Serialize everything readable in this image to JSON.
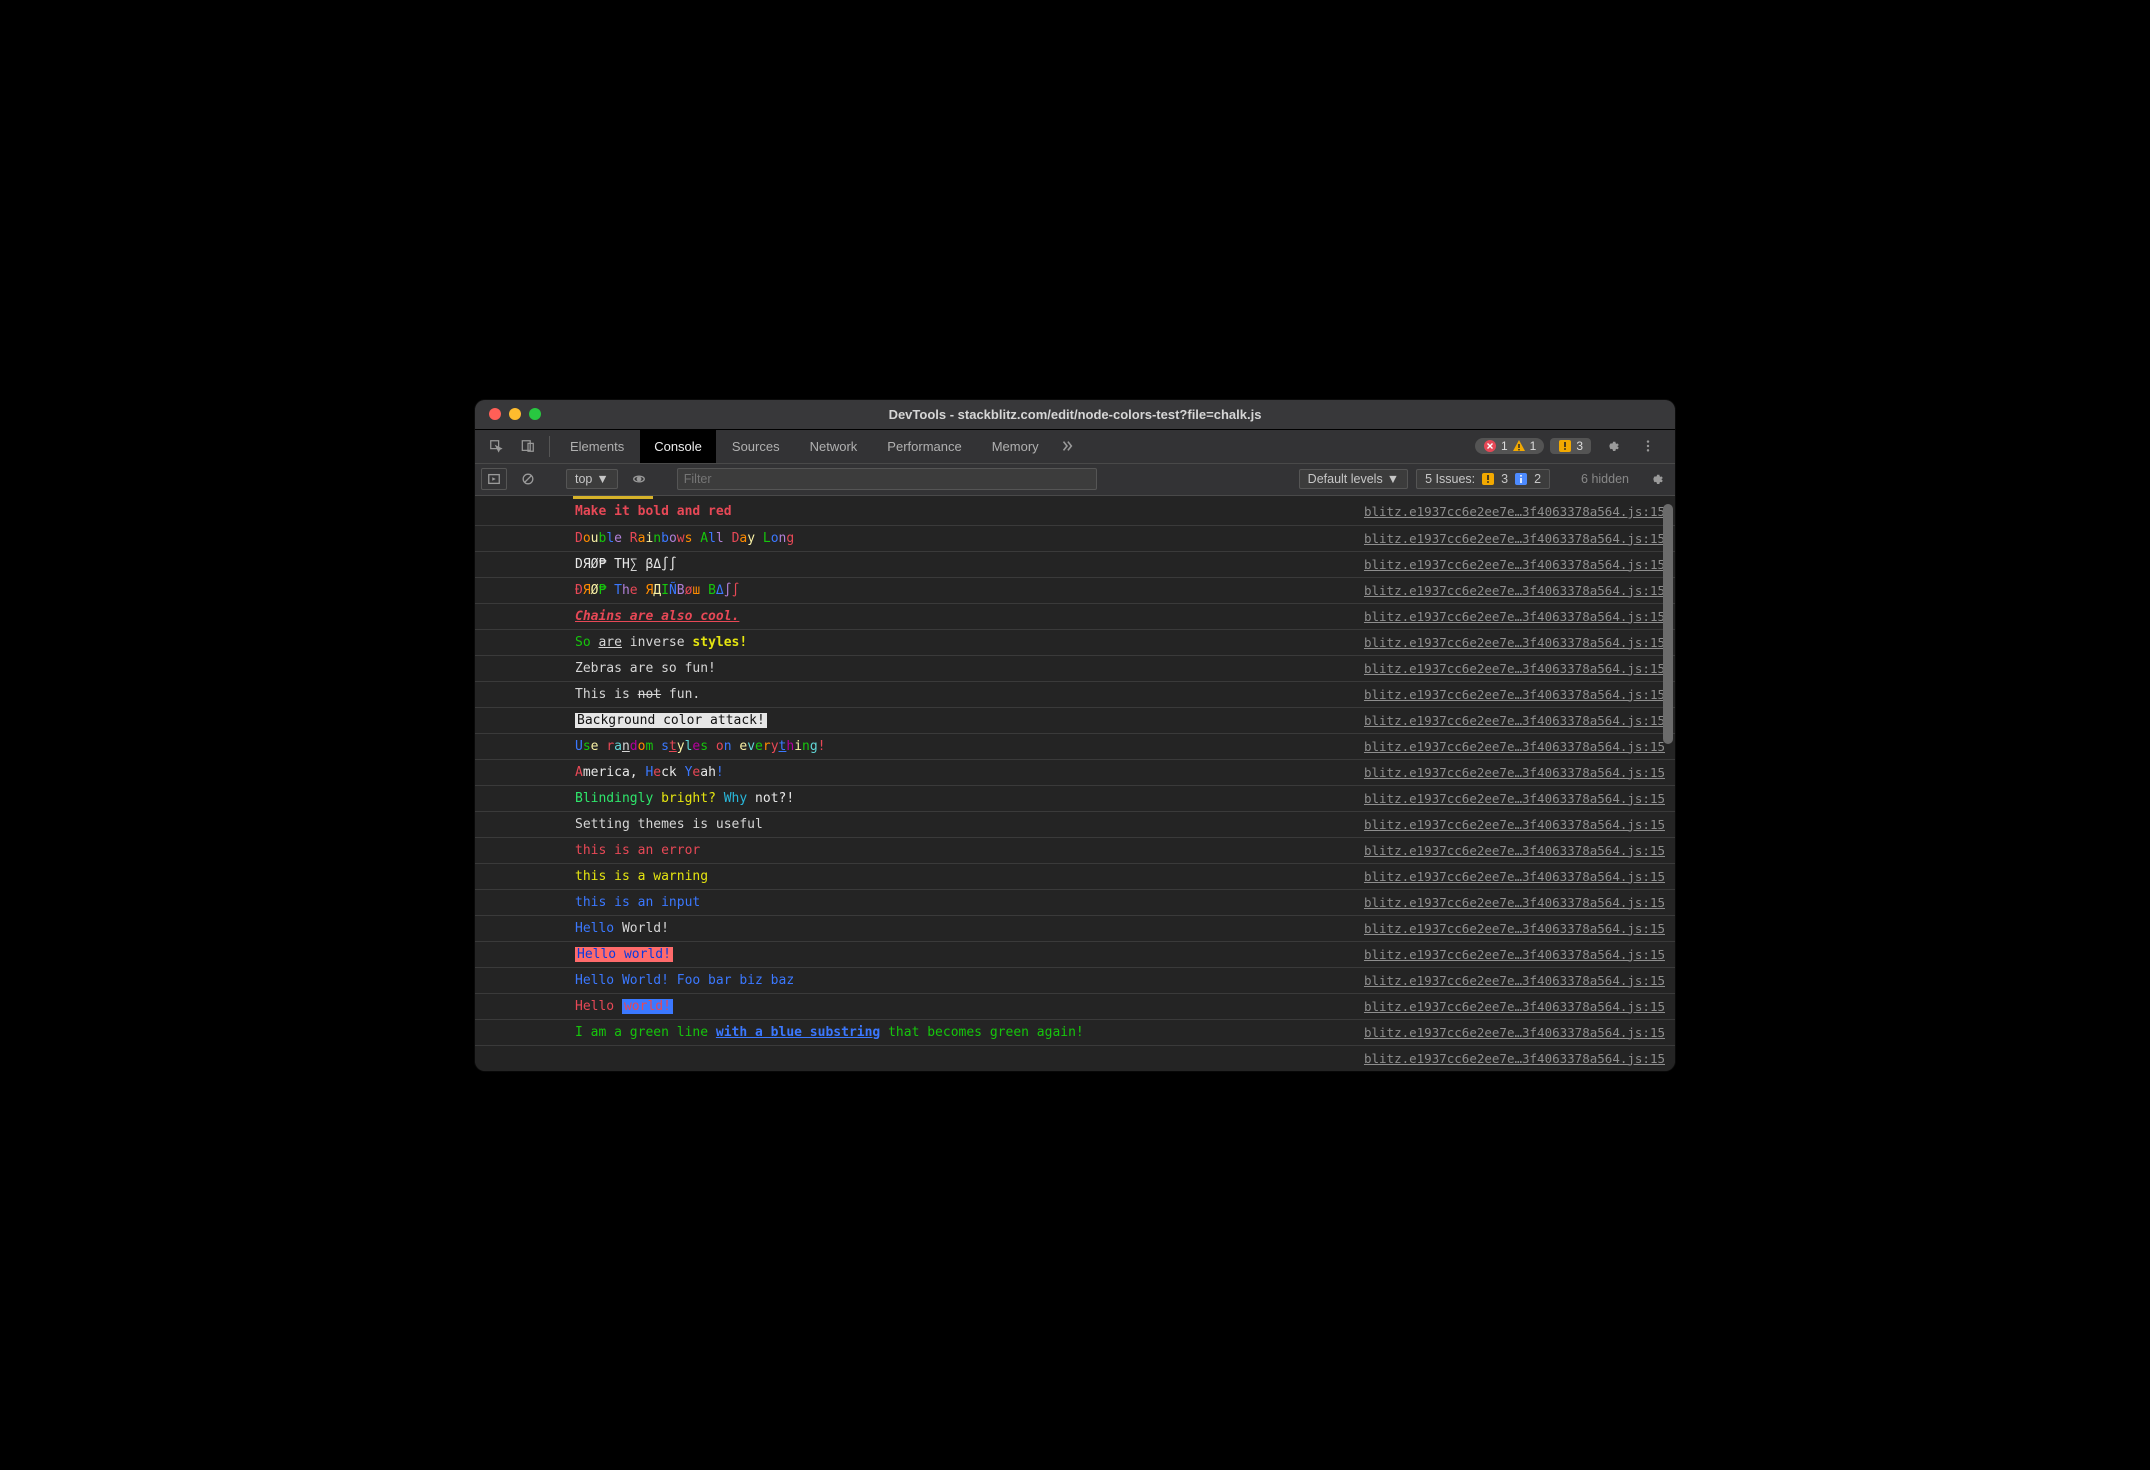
{
  "window": {
    "title": "DevTools - stackblitz.com/edit/node-colors-test?file=chalk.js"
  },
  "tabs": {
    "items": [
      "Elements",
      "Console",
      "Sources",
      "Network",
      "Performance",
      "Memory"
    ],
    "active": "Console",
    "overflow_icon": "chevrons-right-icon",
    "error_count": "1",
    "warn_count": "1",
    "issue_count": "3"
  },
  "toolbar": {
    "context": "top",
    "filter_placeholder": "Filter",
    "levels": "Default levels",
    "issues_label": "5 Issues:",
    "issues_warn": "3",
    "issues_info": "2",
    "hidden": "6 hidden"
  },
  "source_link": "blitz.e1937cc6e2ee7e…3f4063378a564.js:15",
  "lines": [
    {
      "html": "<span class='bold c-red'>Make it bold and red</span>"
    },
    {
      "html": "<span class='c-red'>D</span><span class='c-orange'>o</span><span class='c-yellow'>u</span><span class='c-green'>b</span><span class='c-blue'>l</span><span class='c-purple'>e</span> <span class='c-red'>R</span><span class='c-orange'>a</span><span class='c-yellow'>i</span><span class='c-green'>n</span><span class='c-blue'>b</span><span class='c-purple'>o</span><span class='c-red'>w</span><span class='c-orange'>s</span> <span class='c-green'>A</span><span class='c-blue'>l</span><span class='c-purple'>l</span> <span class='c-red'>D</span><span class='c-orange'>a</span><span class='c-yellow'>y</span> <span class='c-green'>L</span><span class='c-blue'>o</span><span class='c-purple'>n</span><span class='c-red'>g</span>"
    },
    {
      "html": "<span class='c-white'>DЯØ₱ TH∑ βΔ∫∫</span>"
    },
    {
      "html": "<span class='c-red'>Ð</span><span class='c-orange'>Я</span><span class='c-yellow'>Ø</span><span class='c-green'>₱</span> <span class='c-blue'>T</span><span class='c-purple'>h</span><span class='c-red'>e</span> <span class='c-orange'>Я</span><span class='c-yellow'>Д</span><span class='c-green'>I</span><span class='c-blue'>Ñ</span><span class='c-purple'>B</span><span class='c-red'>ø</span><span class='c-orange'>ш</span> <span class='c-green'>B</span><span class='c-blue'>Δ</span><span class='c-purple'>∫</span><span class='c-red'>∫</span>"
    },
    {
      "html": "<span class='bold ita ul c-red'>Chains are also cool.</span>"
    },
    {
      "html": "<span class='c-green'>So</span> <span class='ul'>are</span> inverse <span class='bold c-bryellow'>styles!</span>"
    },
    {
      "html": "Zebras are so fun!"
    },
    {
      "html": "This is <span class='st'>not</span> fun."
    },
    {
      "html": "<span class='bg-white'>Background color attack!</span>"
    },
    {
      "html": "<span class='c-blue'>U</span><span class='c-green'>s</span><span class='c-yellow'>e</span> <span class='c-red'>r</span><span class='c-cyan'>a</span><span class='ul'>n</span><span class='c-mag'>d</span><span class='c-orange'>o</span><span class='c-green'>m</span> <span class='c-blue'>s</span><span class='c-red ul'>t</span><span class='c-yellow'>y</span><span class='c-cyan'>l</span><span class='c-mag'>e</span><span class='c-green'>s</span> <span class='c-red'>o</span><span class='c-blue'>n</span> <span class='c-yellow'>e</span><span class='c-cyan'>v</span><span class='c-green'>e</span><span class='c-orange'>r</span><span class='c-red'>y</span><span class='c-blue ul'>t</span><span class='c-mag'>h</span><span class='c-yellow'>i</span><span class='c-green'>n</span><span class='c-cyan'>g</span><span class='c-red'>!</span>"
    },
    {
      "html": "<span class='c-red'>A</span><span class='c-white'>merica,</span> <span class='c-blue'>H</span><span class='c-red'>e</span><span class='c-white'>ck</span> <span class='c-blue'>Y</span><span class='c-red'>e</span><span class='c-white'>ah</span><span class='c-blue'>!</span>"
    },
    {
      "html": "<span class='c-brgreen'>Blindingly</span> <span class='c-bryellow'>bright?</span> <span class='c-brcyan'>Why</span> <span class='c-white'>not?!</span>"
    },
    {
      "html": "Setting themes is useful"
    },
    {
      "html": "<span class='c-red'>this is an error</span>"
    },
    {
      "html": "<span class='c-bryellow'>this is a warning</span>"
    },
    {
      "html": "<span class='c-blue'>this is an input</span>"
    },
    {
      "html": "<span class='c-blue'>Hello</span> World!"
    },
    {
      "html": "<span class='bg-red'>Hello world!</span>"
    },
    {
      "html": "<span class='c-blue'>Hello World! Foo bar biz baz</span>"
    },
    {
      "html": "<span class='c-red'>Hello </span><span class='bg-blue'>world!</span>"
    },
    {
      "html": "<span class='c-green'>I am a green line </span><span class='bold ul c-blue'>with a blue substring</span><span class='c-green'> that becomes green again!</span>"
    },
    {
      "html": "&nbsp;"
    }
  ]
}
